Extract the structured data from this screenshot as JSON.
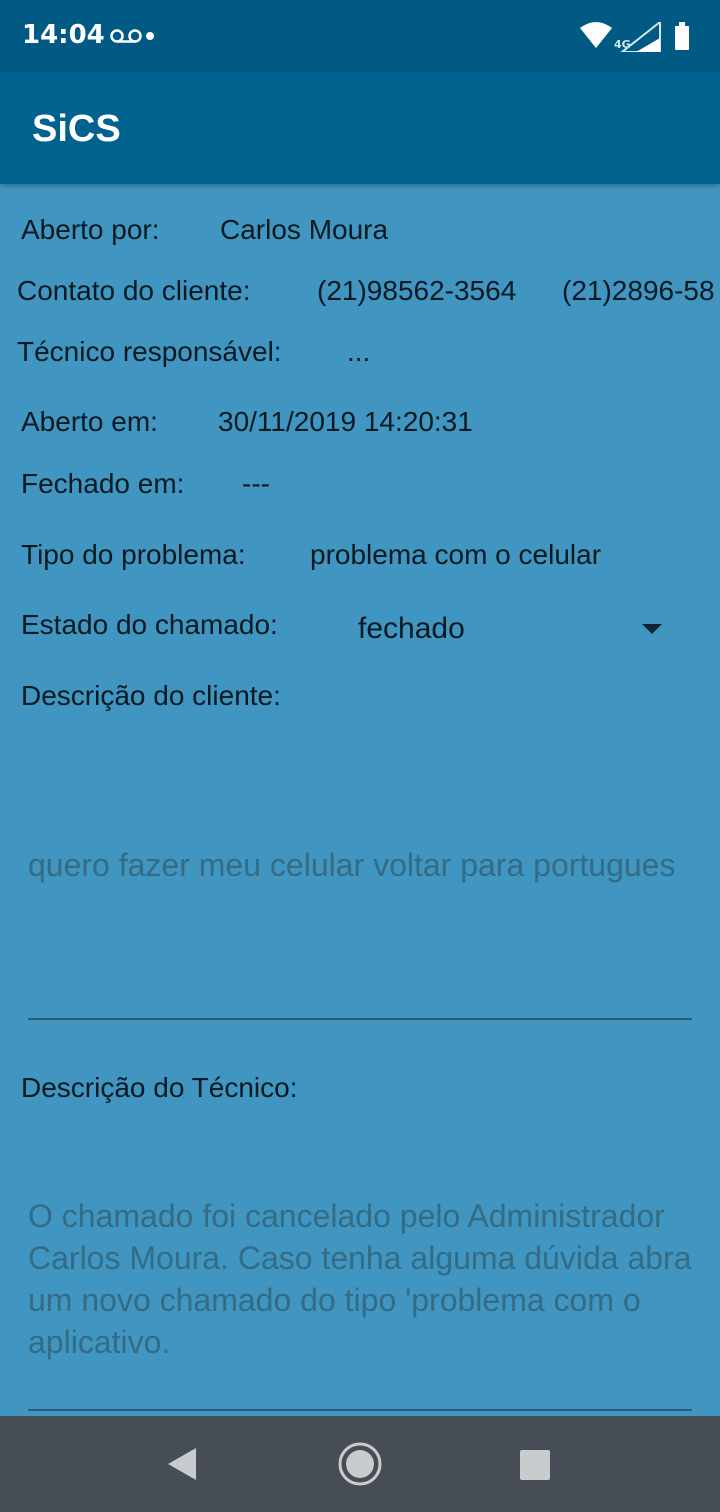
{
  "status_bar": {
    "time": "14:04",
    "network": "4G",
    "icons": [
      "voicemail-icon",
      "notification-dot-icon",
      "wifi-icon",
      "cell-signal-icon",
      "battery-icon"
    ]
  },
  "app_bar": {
    "title": "SiCS"
  },
  "details": {
    "opened_by": {
      "label": "Aberto por:",
      "value": "Carlos Moura"
    },
    "client_contact": {
      "label": "Contato do cliente:",
      "phone1": "(21)98562-3564",
      "phone2": "(21)2896-58"
    },
    "technician": {
      "label": "Técnico responsável:",
      "value": "..."
    },
    "opened_at": {
      "label": "Aberto em:",
      "value": "30/11/2019 14:20:31"
    },
    "closed_at": {
      "label": "Fechado em:",
      "value": "---"
    },
    "problem_type": {
      "label": "Tipo do problema:",
      "value": "problema com o celular"
    },
    "ticket_state": {
      "label": "Estado do chamado:",
      "selected": "fechado"
    },
    "client_description": {
      "label": "Descrição do cliente:",
      "text": "quero fazer meu celular voltar para portugues"
    },
    "technician_description": {
      "label": "Descrição do Técnico:",
      "text": "O chamado foi cancelado pelo Administrador Carlos Moura. Caso tenha alguma dúvida abra um novo chamado do tipo 'problema com o aplicativo."
    }
  },
  "nav_bar": {
    "buttons": [
      "back-icon",
      "home-icon",
      "recents-icon"
    ]
  },
  "colors": {
    "status_bar": "#005a83",
    "app_bar": "#00628e",
    "background": "#4096c0",
    "hint_text": "#346b85",
    "nav_bar": "#474d54"
  }
}
